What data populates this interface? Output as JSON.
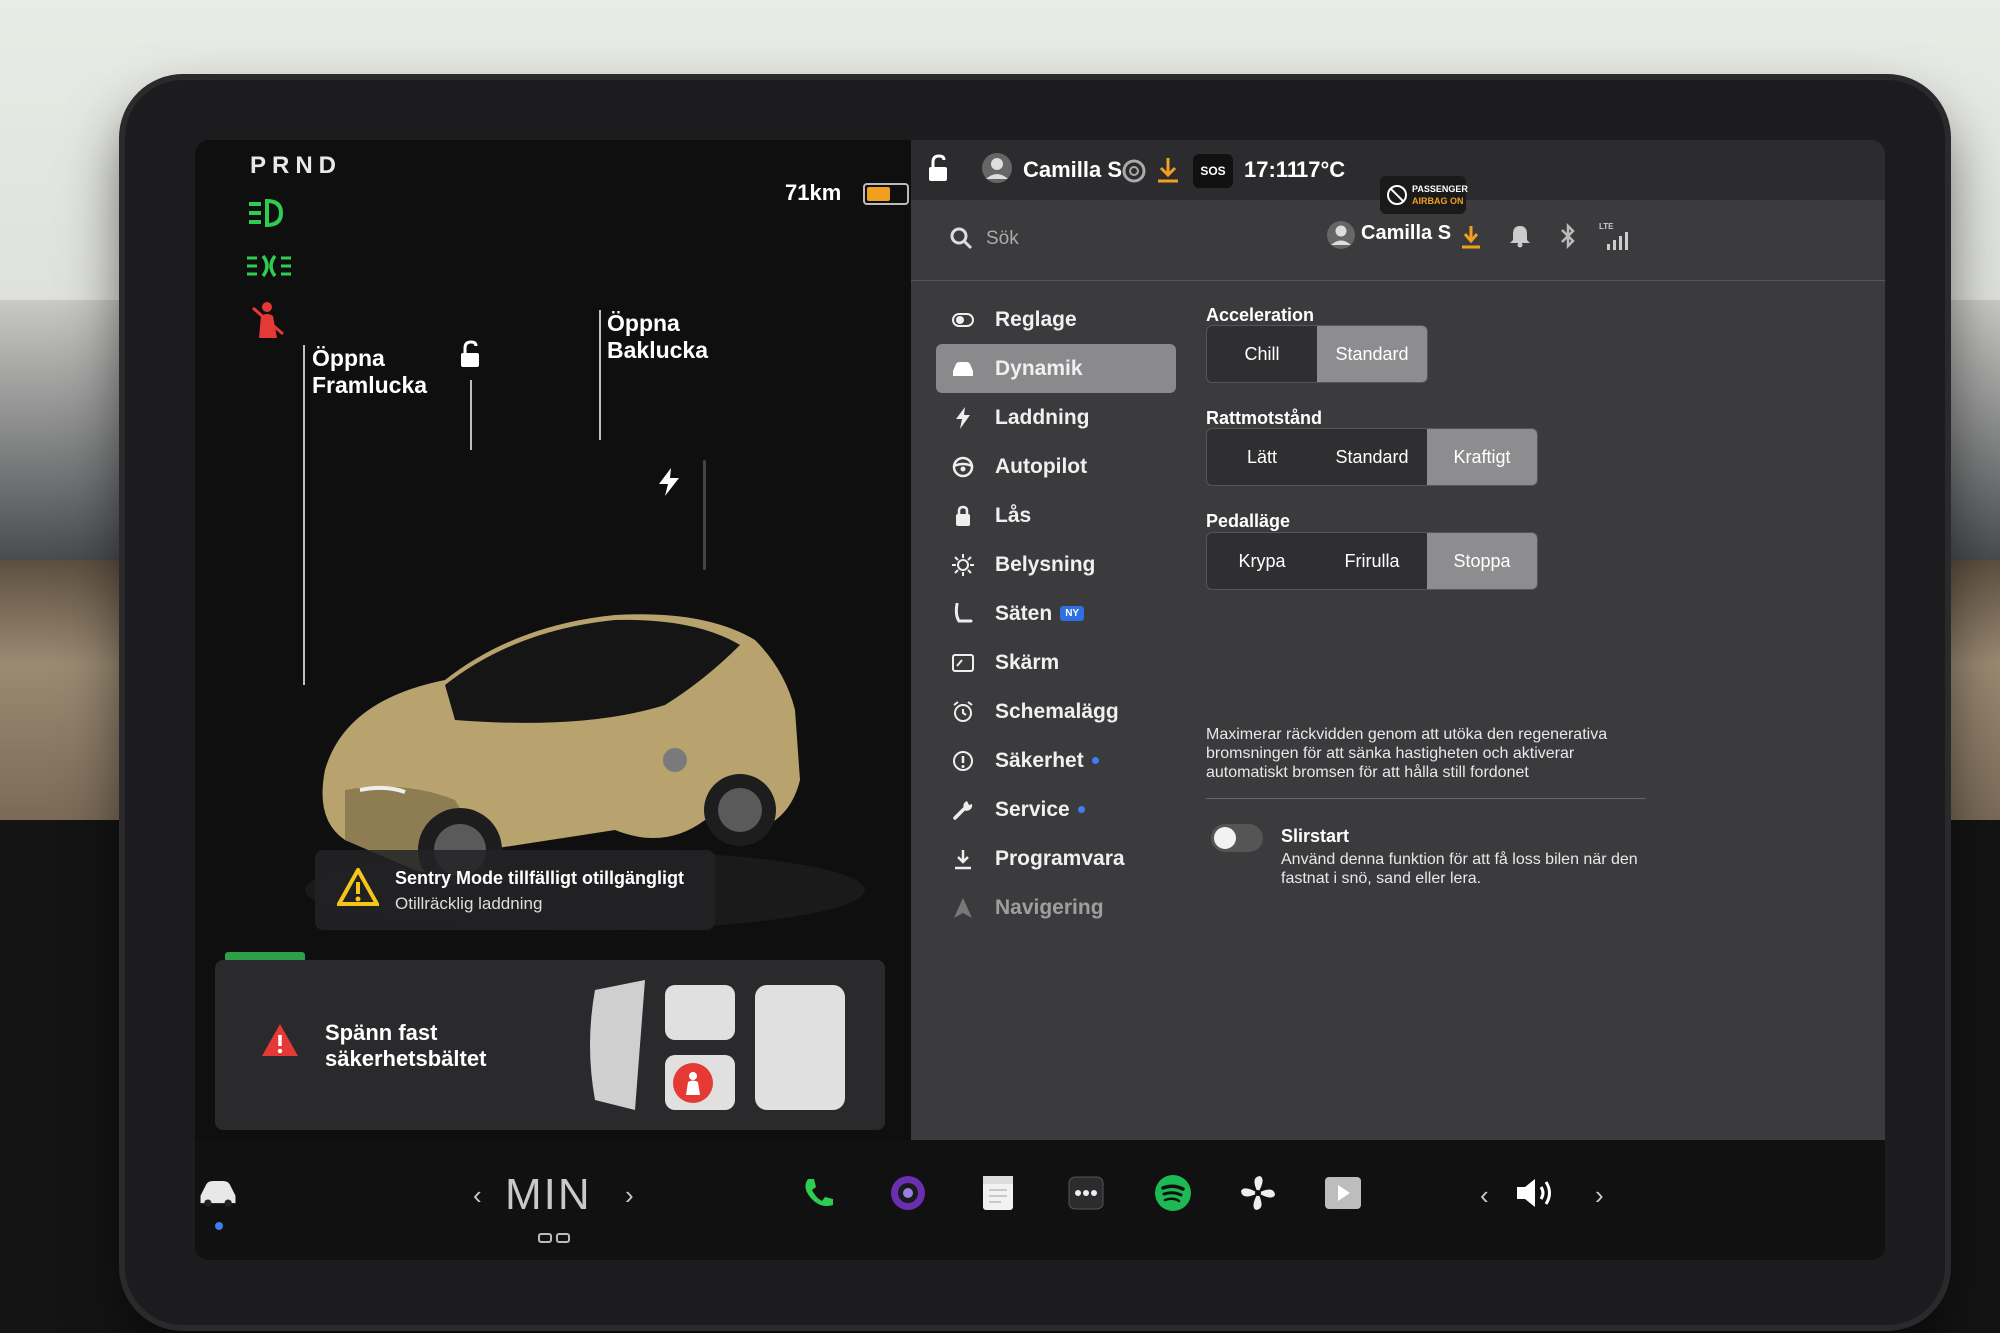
{
  "gear": "PRND",
  "range": "71km",
  "battery_level_pct": 55,
  "car_view": {
    "frunk_label": "Öppna Framlucka",
    "trunk_label": "Öppna Baklucka",
    "sentry_title": "Sentry Mode tillfälligt otillgängligt",
    "sentry_sub": "Otillräcklig laddning",
    "belt_line1": "Spänn fast",
    "belt_line2": "säkerhetsbältet"
  },
  "status": {
    "user": "Camilla S",
    "sos": "SOS",
    "time": "17:11",
    "temp": "17°C",
    "airbag_line1": "PASSENGER",
    "airbag_line2": "AIRBAG ON",
    "lte": "LTE"
  },
  "search": {
    "placeholder": "Sök",
    "user": "Camilla S"
  },
  "menu": [
    {
      "label": "Reglage",
      "icon": "toggle-icon"
    },
    {
      "label": "Dynamik",
      "icon": "car-icon",
      "active": true
    },
    {
      "label": "Laddning",
      "icon": "bolt-icon"
    },
    {
      "label": "Autopilot",
      "icon": "steering-wheel-icon"
    },
    {
      "label": "Lås",
      "icon": "lock-icon"
    },
    {
      "label": "Belysning",
      "icon": "sun-icon"
    },
    {
      "label": "Säten",
      "icon": "seat-icon",
      "badge": "NY"
    },
    {
      "label": "Skärm",
      "icon": "display-icon"
    },
    {
      "label": "Schemalägg",
      "icon": "alarm-clock-icon"
    },
    {
      "label": "Säkerhet",
      "icon": "info-icon",
      "dot": true
    },
    {
      "label": "Service",
      "icon": "wrench-icon",
      "dot": true
    },
    {
      "label": "Programvara",
      "icon": "download-icon"
    },
    {
      "label": "Navigering",
      "icon": "navigation-icon"
    }
  ],
  "settings": {
    "acceleration": {
      "label": "Acceleration",
      "options": [
        "Chill",
        "Standard"
      ],
      "selected": 1
    },
    "steering": {
      "label": "Rattmotstånd",
      "options": [
        "Lätt",
        "Standard",
        "Kraftigt"
      ],
      "selected": 2
    },
    "pedal": {
      "label": "Pedalläge",
      "options": [
        "Krypa",
        "Frirulla",
        "Stoppa"
      ],
      "selected": 2
    },
    "pedal_desc": "Maximerar räckvidden genom att utöka den regenerativa bromsningen för att sänka hastigheten och aktiverar automatiskt bromsen för att hålla still fordonet",
    "slirstart_title": "Slirstart",
    "slirstart_desc": "Använd denna funktion för att få loss bilen när den fastnat i snö, sand eller lera.",
    "slirstart_on": false
  },
  "bottombar": {
    "climate_label": "MIN"
  },
  "colors": {
    "green": "#2ecc50",
    "red": "#e53935",
    "accent_orange": "#f0a020",
    "spotify": "#1db954"
  }
}
